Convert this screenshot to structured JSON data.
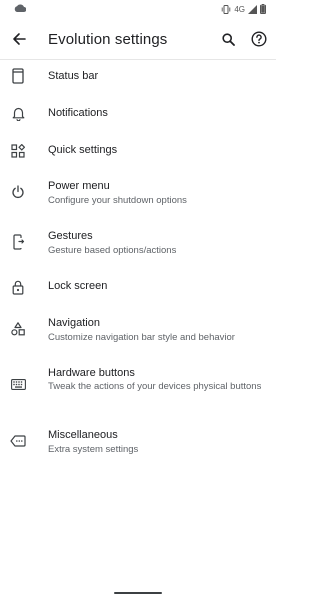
{
  "status_bar": {
    "network": "4G"
  },
  "header": {
    "title": "Evolution settings"
  },
  "items": [
    {
      "title": "Status bar",
      "subtitle": "",
      "icon": "status-bar-icon"
    },
    {
      "title": "Notifications",
      "subtitle": "",
      "icon": "bell-icon"
    },
    {
      "title": "Quick settings",
      "subtitle": "",
      "icon": "quick-settings-icon"
    },
    {
      "title": "Power menu",
      "subtitle": "Configure your shutdown options",
      "icon": "power-icon"
    },
    {
      "title": "Gestures",
      "subtitle": "Gesture based options/actions",
      "icon": "gesture-icon"
    },
    {
      "title": "Lock screen",
      "subtitle": "",
      "icon": "lock-icon"
    },
    {
      "title": "Navigation",
      "subtitle": "Customize navigation bar style and behavior",
      "icon": "shapes-icon"
    },
    {
      "title": "Hardware buttons",
      "subtitle": "Tweak the actions of your devices physical buttons",
      "icon": "keyboard-icon"
    },
    {
      "title": "Miscellaneous",
      "subtitle": "Extra system settings",
      "icon": "label-icon"
    }
  ]
}
